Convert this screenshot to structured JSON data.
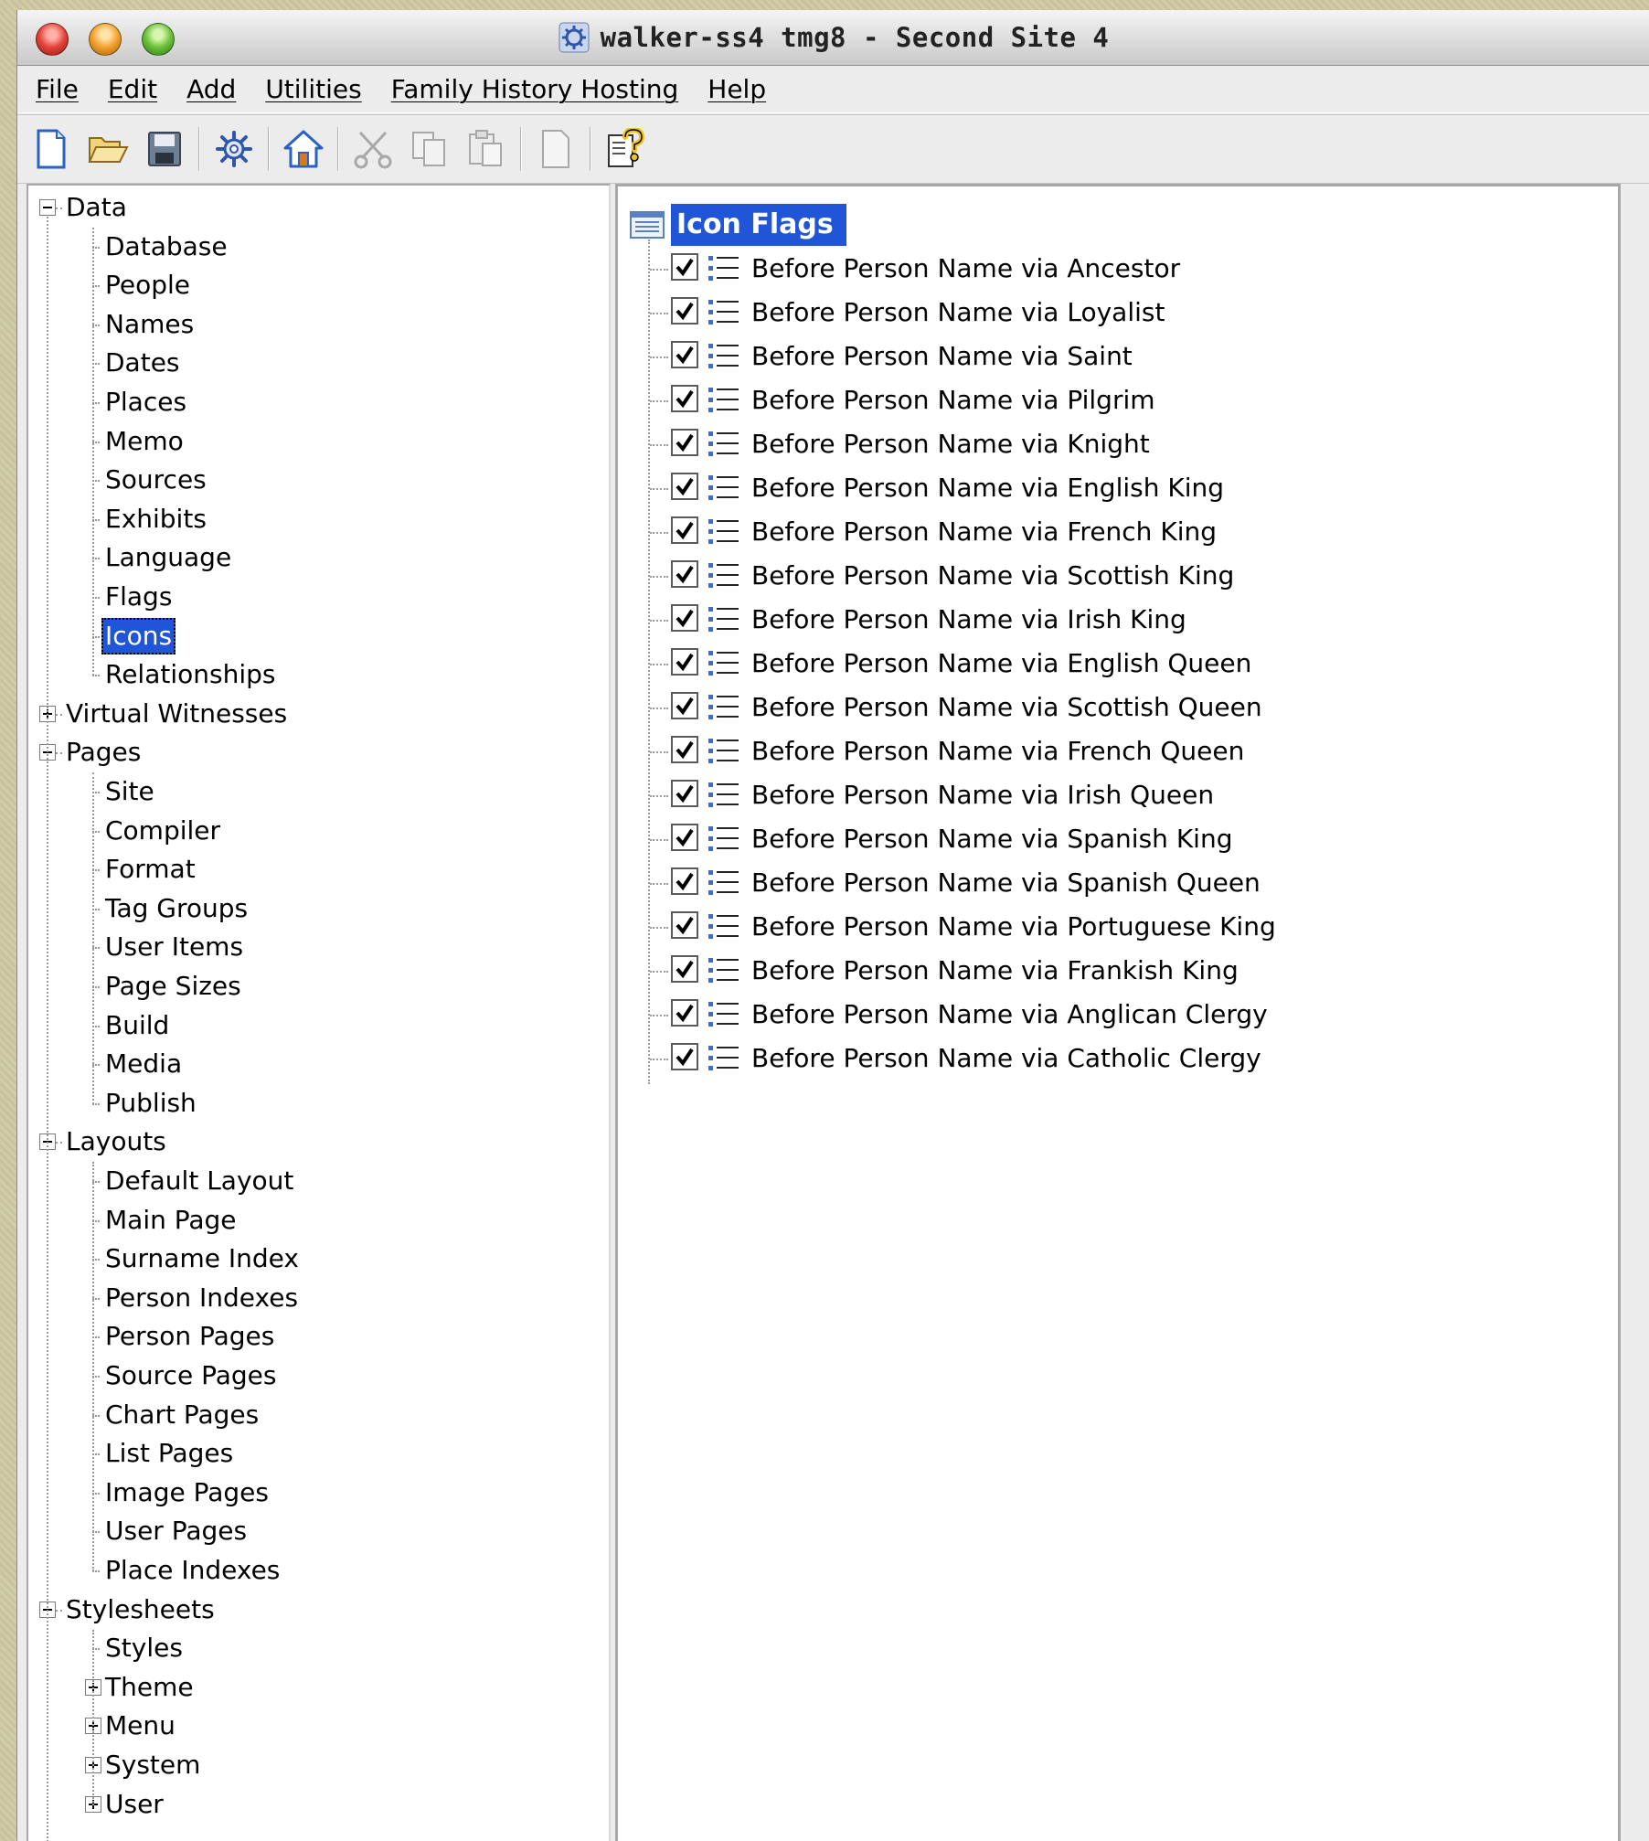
{
  "window": {
    "title": "walker-ss4 tmg8 - Second Site 4",
    "accent_color": "#1f55d6"
  },
  "menubar": {
    "items": [
      "File",
      "Edit",
      "Add",
      "Utilities",
      "Family History Hosting",
      "Help"
    ]
  },
  "toolbar": {
    "buttons": [
      {
        "icon": "new-file-icon"
      },
      {
        "icon": "open-folder-icon"
      },
      {
        "icon": "save-icon"
      },
      {
        "icon": "settings-gear-icon"
      },
      {
        "icon": "home-icon"
      },
      {
        "icon": "cut-icon"
      },
      {
        "icon": "copy-icon"
      },
      {
        "icon": "paste-icon"
      },
      {
        "icon": "blank-page-icon"
      },
      {
        "icon": "help-icon"
      }
    ]
  },
  "tree": {
    "selected": "Icons",
    "nodes": [
      {
        "label": "Data",
        "level": 0,
        "expander": "minus"
      },
      {
        "label": "Database",
        "level": 1
      },
      {
        "label": "People",
        "level": 1
      },
      {
        "label": "Names",
        "level": 1
      },
      {
        "label": "Dates",
        "level": 1
      },
      {
        "label": "Places",
        "level": 1
      },
      {
        "label": "Memo",
        "level": 1
      },
      {
        "label": "Sources",
        "level": 1
      },
      {
        "label": "Exhibits",
        "level": 1
      },
      {
        "label": "Language",
        "level": 1
      },
      {
        "label": "Flags",
        "level": 1
      },
      {
        "label": "Icons",
        "level": 1
      },
      {
        "label": "Relationships",
        "level": 1
      },
      {
        "label": "Virtual Witnesses",
        "level": 0,
        "expander": "plus"
      },
      {
        "label": "Pages",
        "level": 0,
        "expander": "minus"
      },
      {
        "label": "Site",
        "level": 1
      },
      {
        "label": "Compiler",
        "level": 1
      },
      {
        "label": "Format",
        "level": 1
      },
      {
        "label": "Tag Groups",
        "level": 1
      },
      {
        "label": "User Items",
        "level": 1
      },
      {
        "label": "Page Sizes",
        "level": 1
      },
      {
        "label": "Build",
        "level": 1
      },
      {
        "label": "Media",
        "level": 1
      },
      {
        "label": "Publish",
        "level": 1
      },
      {
        "label": "Layouts",
        "level": 0,
        "expander": "minus"
      },
      {
        "label": "Default Layout",
        "level": 1
      },
      {
        "label": "Main Page",
        "level": 1
      },
      {
        "label": "Surname Index",
        "level": 1
      },
      {
        "label": "Person Indexes",
        "level": 1
      },
      {
        "label": "Person Pages",
        "level": 1
      },
      {
        "label": "Source Pages",
        "level": 1
      },
      {
        "label": "Chart Pages",
        "level": 1
      },
      {
        "label": "List Pages",
        "level": 1
      },
      {
        "label": "Image Pages",
        "level": 1
      },
      {
        "label": "User Pages",
        "level": 1
      },
      {
        "label": "Place Indexes",
        "level": 1
      },
      {
        "label": "Stylesheets",
        "level": 0,
        "expander": "minus"
      },
      {
        "label": "Styles",
        "level": 1
      },
      {
        "label": "Theme",
        "level": 1,
        "expander": "plus"
      },
      {
        "label": "Menu",
        "level": 1,
        "expander": "plus"
      },
      {
        "label": "System",
        "level": 1,
        "expander": "plus"
      },
      {
        "label": "User",
        "level": 1,
        "expander": "plus"
      }
    ]
  },
  "content": {
    "header": "Icon Flags",
    "header_icon": "list-panel-icon",
    "flags": [
      {
        "label": "Before Person Name via Ancestor",
        "checked": true
      },
      {
        "label": "Before Person Name via Loyalist",
        "checked": true
      },
      {
        "label": "Before Person Name via Saint",
        "checked": true
      },
      {
        "label": "Before Person Name via Pilgrim",
        "checked": true
      },
      {
        "label": "Before Person Name via Knight",
        "checked": true
      },
      {
        "label": "Before Person Name via English King",
        "checked": true
      },
      {
        "label": "Before Person Name via French King",
        "checked": true
      },
      {
        "label": "Before Person Name via Scottish King",
        "checked": true
      },
      {
        "label": "Before Person Name via Irish King",
        "checked": true
      },
      {
        "label": "Before Person Name via English Queen",
        "checked": true
      },
      {
        "label": "Before Person Name via Scottish Queen",
        "checked": true
      },
      {
        "label": "Before Person Name via French Queen",
        "checked": true
      },
      {
        "label": "Before Person Name via Irish Queen",
        "checked": true
      },
      {
        "label": "Before Person Name via Spanish King",
        "checked": true
      },
      {
        "label": "Before Person Name via Spanish Queen",
        "checked": true
      },
      {
        "label": "Before Person Name via Portuguese King",
        "checked": true
      },
      {
        "label": "Before Person Name via Frankish King",
        "checked": true
      },
      {
        "label": "Before Person Name via Anglican Clergy",
        "checked": true
      },
      {
        "label": "Before Person Name via Catholic Clergy",
        "checked": true
      }
    ]
  }
}
